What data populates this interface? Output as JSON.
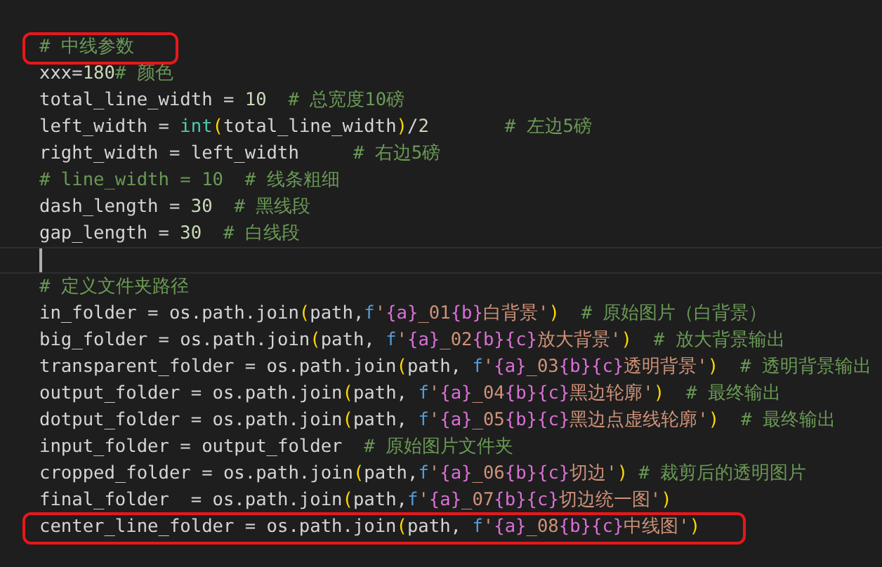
{
  "editor": {
    "lines": [
      {
        "kind": "blank"
      },
      {
        "kind": "code",
        "framed": true,
        "tokens": [
          {
            "kind": "comment",
            "text": "# 中线参数"
          }
        ]
      },
      {
        "kind": "code",
        "tokens": [
          {
            "kind": "text",
            "text": "xxx="
          },
          {
            "kind": "number",
            "text": "180"
          },
          {
            "kind": "comment",
            "text": "# 颜色"
          }
        ]
      },
      {
        "kind": "code",
        "tokens": [
          {
            "kind": "text",
            "text": "total_line_width = "
          },
          {
            "kind": "number",
            "text": "10"
          },
          {
            "kind": "comment",
            "text": "  # 总宽度10磅"
          }
        ]
      },
      {
        "kind": "code",
        "tokens": [
          {
            "kind": "text",
            "text": "left_width = "
          },
          {
            "kind": "builtin",
            "text": "int"
          },
          {
            "kind": "paren",
            "text": "("
          },
          {
            "kind": "text",
            "text": "total_line_width"
          },
          {
            "kind": "paren",
            "text": ")"
          },
          {
            "kind": "text",
            "text": "/"
          },
          {
            "kind": "number",
            "text": "2"
          },
          {
            "kind": "comment",
            "text": "       # 左边5磅"
          }
        ]
      },
      {
        "kind": "code",
        "tokens": [
          {
            "kind": "text",
            "text": "right_width = left_width     "
          },
          {
            "kind": "comment",
            "text": "# 右边5磅"
          }
        ]
      },
      {
        "kind": "code",
        "tokens": [
          {
            "kind": "comment",
            "text": "# line_width = 10  # 线条粗细"
          }
        ]
      },
      {
        "kind": "code",
        "tokens": [
          {
            "kind": "text",
            "text": "dash_length = "
          },
          {
            "kind": "number",
            "text": "30"
          },
          {
            "kind": "comment",
            "text": "  # 黑线段"
          }
        ]
      },
      {
        "kind": "code",
        "tokens": [
          {
            "kind": "text",
            "text": "gap_length = "
          },
          {
            "kind": "number",
            "text": "30"
          },
          {
            "kind": "comment",
            "text": "  # 白线段"
          }
        ]
      },
      {
        "kind": "cursor"
      },
      {
        "kind": "code",
        "tokens": [
          {
            "kind": "comment",
            "text": "# 定义文件夹路径"
          }
        ]
      },
      {
        "kind": "code",
        "tokens": [
          {
            "kind": "text",
            "text": "in_folder = os.path.join"
          },
          {
            "kind": "paren",
            "text": "("
          },
          {
            "kind": "text",
            "text": "path,"
          },
          {
            "kind": "fprefix",
            "text": "f"
          },
          {
            "kind": "string",
            "text": "'"
          },
          {
            "kind": "interp",
            "text": "{a}"
          },
          {
            "kind": "string",
            "text": "_01"
          },
          {
            "kind": "interp",
            "text": "{b}"
          },
          {
            "kind": "string",
            "text": "白背景'"
          },
          {
            "kind": "paren",
            "text": ")"
          },
          {
            "kind": "comment",
            "text": "  # 原始图片（白背景）"
          }
        ]
      },
      {
        "kind": "code",
        "tokens": [
          {
            "kind": "text",
            "text": "big_folder = os.path.join"
          },
          {
            "kind": "paren",
            "text": "("
          },
          {
            "kind": "text",
            "text": "path, "
          },
          {
            "kind": "fprefix",
            "text": "f"
          },
          {
            "kind": "string",
            "text": "'"
          },
          {
            "kind": "interp",
            "text": "{a}"
          },
          {
            "kind": "string",
            "text": "_02"
          },
          {
            "kind": "interp",
            "text": "{b}{c}"
          },
          {
            "kind": "string",
            "text": "放大背景'"
          },
          {
            "kind": "paren",
            "text": ")"
          },
          {
            "kind": "comment",
            "text": "  # 放大背景输出"
          }
        ]
      },
      {
        "kind": "code",
        "tokens": [
          {
            "kind": "text",
            "text": "transparent_folder = os.path.join"
          },
          {
            "kind": "paren",
            "text": "("
          },
          {
            "kind": "text",
            "text": "path, "
          },
          {
            "kind": "fprefix",
            "text": "f"
          },
          {
            "kind": "string",
            "text": "'"
          },
          {
            "kind": "interp",
            "text": "{a}"
          },
          {
            "kind": "string",
            "text": "_03"
          },
          {
            "kind": "interp",
            "text": "{b}{c}"
          },
          {
            "kind": "string",
            "text": "透明背景'"
          },
          {
            "kind": "paren",
            "text": ")"
          },
          {
            "kind": "comment",
            "text": "  # 透明背景输出"
          }
        ]
      },
      {
        "kind": "code",
        "tokens": [
          {
            "kind": "text",
            "text": "output_folder = os.path.join"
          },
          {
            "kind": "paren",
            "text": "("
          },
          {
            "kind": "text",
            "text": "path, "
          },
          {
            "kind": "fprefix",
            "text": "f"
          },
          {
            "kind": "string",
            "text": "'"
          },
          {
            "kind": "interp",
            "text": "{a}"
          },
          {
            "kind": "string",
            "text": "_04"
          },
          {
            "kind": "interp",
            "text": "{b}{c}"
          },
          {
            "kind": "string",
            "text": "黑边轮廓'"
          },
          {
            "kind": "paren",
            "text": ")"
          },
          {
            "kind": "comment",
            "text": "  # 最终输出"
          }
        ]
      },
      {
        "kind": "code",
        "tokens": [
          {
            "kind": "text",
            "text": "dotput_folder = os.path.join"
          },
          {
            "kind": "paren",
            "text": "("
          },
          {
            "kind": "text",
            "text": "path, "
          },
          {
            "kind": "fprefix",
            "text": "f"
          },
          {
            "kind": "string",
            "text": "'"
          },
          {
            "kind": "interp",
            "text": "{a}"
          },
          {
            "kind": "string",
            "text": "_05"
          },
          {
            "kind": "interp",
            "text": "{b}{c}"
          },
          {
            "kind": "string",
            "text": "黑边点虚线轮廓'"
          },
          {
            "kind": "paren",
            "text": ")"
          },
          {
            "kind": "comment",
            "text": "  # 最终输出"
          }
        ]
      },
      {
        "kind": "code",
        "tokens": [
          {
            "kind": "text",
            "text": "input_folder = output_folder  "
          },
          {
            "kind": "comment",
            "text": "# 原始图片文件夹"
          }
        ]
      },
      {
        "kind": "code",
        "tokens": [
          {
            "kind": "text",
            "text": "cropped_folder = os.path.join"
          },
          {
            "kind": "paren",
            "text": "("
          },
          {
            "kind": "text",
            "text": "path,"
          },
          {
            "kind": "fprefix",
            "text": "f"
          },
          {
            "kind": "string",
            "text": "'"
          },
          {
            "kind": "interp",
            "text": "{a}"
          },
          {
            "kind": "string",
            "text": "_06"
          },
          {
            "kind": "interp",
            "text": "{b}{c}"
          },
          {
            "kind": "string",
            "text": "切边'"
          },
          {
            "kind": "paren",
            "text": ")"
          },
          {
            "kind": "comment",
            "text": " # 裁剪后的透明图片"
          }
        ]
      },
      {
        "kind": "code",
        "tokens": [
          {
            "kind": "text",
            "text": "final_folder  = os.path.join"
          },
          {
            "kind": "paren",
            "text": "("
          },
          {
            "kind": "text",
            "text": "path,"
          },
          {
            "kind": "fprefix",
            "text": "f"
          },
          {
            "kind": "string",
            "text": "'"
          },
          {
            "kind": "interp",
            "text": "{a}"
          },
          {
            "kind": "string",
            "text": "_07"
          },
          {
            "kind": "interp",
            "text": "{b}{c}"
          },
          {
            "kind": "string",
            "text": "切边统一图'"
          },
          {
            "kind": "paren",
            "text": ")"
          }
        ]
      },
      {
        "kind": "code",
        "framed": true,
        "tokens": [
          {
            "kind": "text",
            "text": "center_line_folder = os.path.join"
          },
          {
            "kind": "paren",
            "text": "("
          },
          {
            "kind": "text",
            "text": "path, "
          },
          {
            "kind": "fprefix",
            "text": "f"
          },
          {
            "kind": "string",
            "text": "'"
          },
          {
            "kind": "interp",
            "text": "{a}"
          },
          {
            "kind": "string",
            "text": "_08"
          },
          {
            "kind": "interp",
            "text": "{b}{c}"
          },
          {
            "kind": "string",
            "text": "中线图'"
          },
          {
            "kind": "paren",
            "text": ")"
          }
        ]
      },
      {
        "kind": "blank"
      }
    ]
  }
}
